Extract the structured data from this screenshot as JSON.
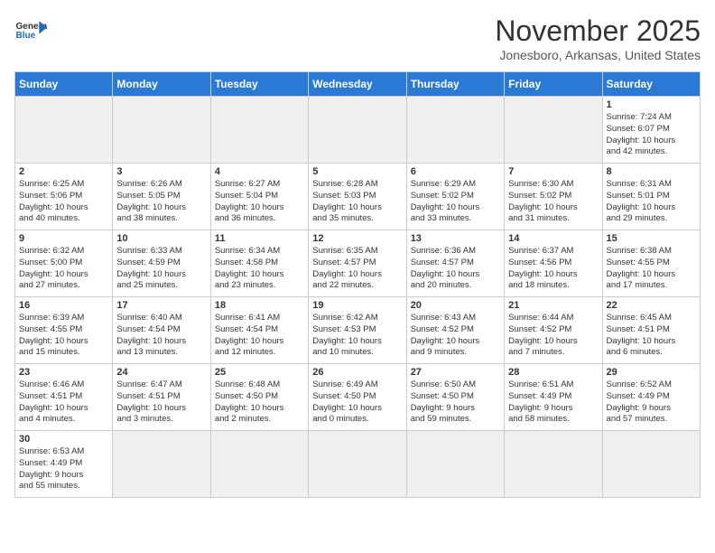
{
  "logo": {
    "general": "General",
    "blue": "Blue"
  },
  "title": "November 2025",
  "location": "Jonesboro, Arkansas, United States",
  "weekdays": [
    "Sunday",
    "Monday",
    "Tuesday",
    "Wednesday",
    "Thursday",
    "Friday",
    "Saturday"
  ],
  "weeks": [
    [
      {
        "day": "",
        "empty": true
      },
      {
        "day": "",
        "empty": true
      },
      {
        "day": "",
        "empty": true
      },
      {
        "day": "",
        "empty": true
      },
      {
        "day": "",
        "empty": true
      },
      {
        "day": "",
        "empty": true
      },
      {
        "day": "1",
        "info": "Sunrise: 7:24 AM\nSunset: 6:07 PM\nDaylight: 10 hours\nand 42 minutes."
      }
    ],
    [
      {
        "day": "2",
        "info": "Sunrise: 6:25 AM\nSunset: 5:06 PM\nDaylight: 10 hours\nand 40 minutes."
      },
      {
        "day": "3",
        "info": "Sunrise: 6:26 AM\nSunset: 5:05 PM\nDaylight: 10 hours\nand 38 minutes."
      },
      {
        "day": "4",
        "info": "Sunrise: 6:27 AM\nSunset: 5:04 PM\nDaylight: 10 hours\nand 36 minutes."
      },
      {
        "day": "5",
        "info": "Sunrise: 6:28 AM\nSunset: 5:03 PM\nDaylight: 10 hours\nand 35 minutes."
      },
      {
        "day": "6",
        "info": "Sunrise: 6:29 AM\nSunset: 5:02 PM\nDaylight: 10 hours\nand 33 minutes."
      },
      {
        "day": "7",
        "info": "Sunrise: 6:30 AM\nSunset: 5:02 PM\nDaylight: 10 hours\nand 31 minutes."
      },
      {
        "day": "8",
        "info": "Sunrise: 6:31 AM\nSunset: 5:01 PM\nDaylight: 10 hours\nand 29 minutes."
      }
    ],
    [
      {
        "day": "9",
        "info": "Sunrise: 6:32 AM\nSunset: 5:00 PM\nDaylight: 10 hours\nand 27 minutes."
      },
      {
        "day": "10",
        "info": "Sunrise: 6:33 AM\nSunset: 4:59 PM\nDaylight: 10 hours\nand 25 minutes."
      },
      {
        "day": "11",
        "info": "Sunrise: 6:34 AM\nSunset: 4:58 PM\nDaylight: 10 hours\nand 23 minutes."
      },
      {
        "day": "12",
        "info": "Sunrise: 6:35 AM\nSunset: 4:57 PM\nDaylight: 10 hours\nand 22 minutes."
      },
      {
        "day": "13",
        "info": "Sunrise: 6:36 AM\nSunset: 4:57 PM\nDaylight: 10 hours\nand 20 minutes."
      },
      {
        "day": "14",
        "info": "Sunrise: 6:37 AM\nSunset: 4:56 PM\nDaylight: 10 hours\nand 18 minutes."
      },
      {
        "day": "15",
        "info": "Sunrise: 6:38 AM\nSunset: 4:55 PM\nDaylight: 10 hours\nand 17 minutes."
      }
    ],
    [
      {
        "day": "16",
        "info": "Sunrise: 6:39 AM\nSunset: 4:55 PM\nDaylight: 10 hours\nand 15 minutes."
      },
      {
        "day": "17",
        "info": "Sunrise: 6:40 AM\nSunset: 4:54 PM\nDaylight: 10 hours\nand 13 minutes."
      },
      {
        "day": "18",
        "info": "Sunrise: 6:41 AM\nSunset: 4:54 PM\nDaylight: 10 hours\nand 12 minutes."
      },
      {
        "day": "19",
        "info": "Sunrise: 6:42 AM\nSunset: 4:53 PM\nDaylight: 10 hours\nand 10 minutes."
      },
      {
        "day": "20",
        "info": "Sunrise: 6:43 AM\nSunset: 4:52 PM\nDaylight: 10 hours\nand 9 minutes."
      },
      {
        "day": "21",
        "info": "Sunrise: 6:44 AM\nSunset: 4:52 PM\nDaylight: 10 hours\nand 7 minutes."
      },
      {
        "day": "22",
        "info": "Sunrise: 6:45 AM\nSunset: 4:51 PM\nDaylight: 10 hours\nand 6 minutes."
      }
    ],
    [
      {
        "day": "23",
        "info": "Sunrise: 6:46 AM\nSunset: 4:51 PM\nDaylight: 10 hours\nand 4 minutes."
      },
      {
        "day": "24",
        "info": "Sunrise: 6:47 AM\nSunset: 4:51 PM\nDaylight: 10 hours\nand 3 minutes."
      },
      {
        "day": "25",
        "info": "Sunrise: 6:48 AM\nSunset: 4:50 PM\nDaylight: 10 hours\nand 2 minutes."
      },
      {
        "day": "26",
        "info": "Sunrise: 6:49 AM\nSunset: 4:50 PM\nDaylight: 10 hours\nand 0 minutes."
      },
      {
        "day": "27",
        "info": "Sunrise: 6:50 AM\nSunset: 4:50 PM\nDaylight: 9 hours\nand 59 minutes."
      },
      {
        "day": "28",
        "info": "Sunrise: 6:51 AM\nSunset: 4:49 PM\nDaylight: 9 hours\nand 58 minutes."
      },
      {
        "day": "29",
        "info": "Sunrise: 6:52 AM\nSunset: 4:49 PM\nDaylight: 9 hours\nand 57 minutes."
      }
    ],
    [
      {
        "day": "30",
        "info": "Sunrise: 6:53 AM\nSunset: 4:49 PM\nDaylight: 9 hours\nand 55 minutes."
      },
      {
        "day": "",
        "empty": true
      },
      {
        "day": "",
        "empty": true
      },
      {
        "day": "",
        "empty": true
      },
      {
        "day": "",
        "empty": true
      },
      {
        "day": "",
        "empty": true
      },
      {
        "day": "",
        "empty": true
      }
    ]
  ]
}
